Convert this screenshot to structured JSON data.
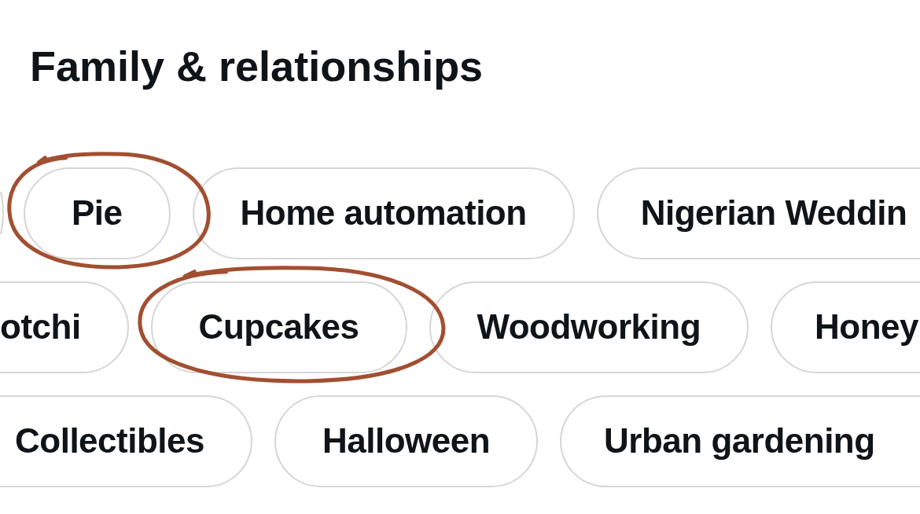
{
  "heading": "Family & relationships",
  "rows": [
    {
      "chips": [
        {
          "kind": "edge"
        },
        {
          "kind": "full",
          "label": "Pie",
          "circled": true
        },
        {
          "kind": "full",
          "label": "Home automation",
          "circled": false
        },
        {
          "kind": "cut_right",
          "label": "Nigerian Weddin",
          "circled": false
        }
      ]
    },
    {
      "chips": [
        {
          "kind": "cut_left",
          "label": "otchi",
          "circled": false
        },
        {
          "kind": "full",
          "label": "Cupcakes",
          "circled": true
        },
        {
          "kind": "full",
          "label": "Woodworking",
          "circled": false
        },
        {
          "kind": "cut_right",
          "label": "Honey",
          "circled": false
        }
      ]
    },
    {
      "chips": [
        {
          "kind": "cut_left",
          "label": "Collectibles",
          "circled": false
        },
        {
          "kind": "full",
          "label": "Halloween",
          "circled": false
        },
        {
          "kind": "cut_right",
          "label": "Urban gardening",
          "circled": false
        }
      ]
    }
  ]
}
